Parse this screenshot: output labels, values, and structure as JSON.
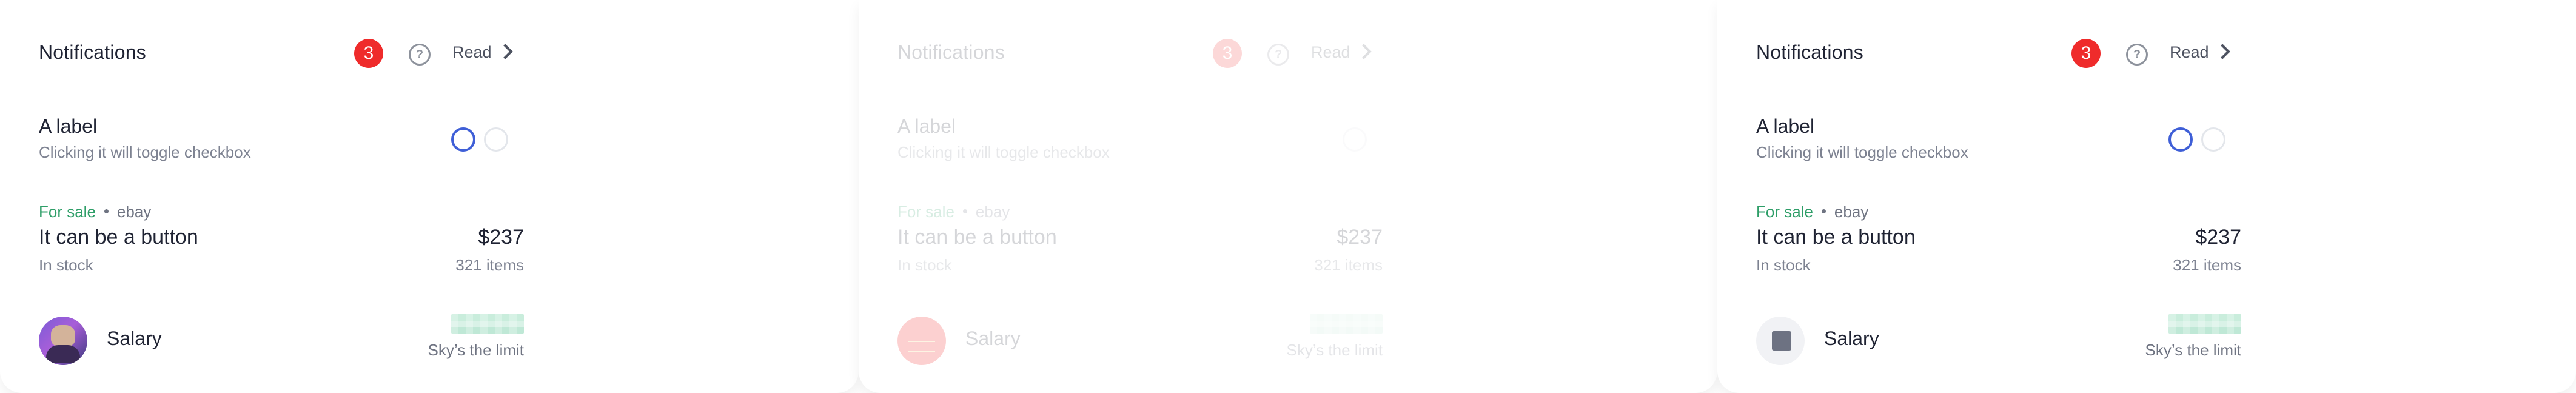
{
  "colors": {
    "badge": "#ef2b2b",
    "accent": "#3f5fd7",
    "sale": "#2e9e68",
    "text": "#1f2333",
    "muted": "#7d8291"
  },
  "panels": [
    {
      "state": "default",
      "header": {
        "title": "Notifications",
        "count": "3",
        "read_label": "Read"
      },
      "checkbox": {
        "label": "A label",
        "sub": "Clicking it will toggle checkbox"
      },
      "item": {
        "status": "For sale",
        "source": "ebay",
        "title": "It can be a button",
        "subtitle": "In stock",
        "price": "$237",
        "count": "321 items"
      },
      "salary": {
        "label": "Salary",
        "limit": "Sky’s the limit",
        "avatar": "photo"
      }
    },
    {
      "state": "disabled",
      "header": {
        "title": "Notifications",
        "count": "3",
        "read_label": "Read"
      },
      "checkbox": {
        "label": "A label",
        "sub": "Clicking it will toggle checkbox"
      },
      "item": {
        "status": "For sale",
        "source": "ebay",
        "title": "It can be a button",
        "subtitle": "In stock",
        "price": "$237",
        "count": "321 items"
      },
      "salary": {
        "label": "Salary",
        "limit": "Sky’s the limit",
        "avatar": "red"
      }
    },
    {
      "state": "default",
      "header": {
        "title": "Notifications",
        "count": "3",
        "read_label": "Read"
      },
      "checkbox": {
        "label": "A label",
        "sub": "Clicking it will toggle checkbox"
      },
      "item": {
        "status": "For sale",
        "source": "ebay",
        "title": "It can be a button",
        "subtitle": "In stock",
        "price": "$237",
        "count": "321 items"
      },
      "salary": {
        "label": "Salary",
        "limit": "Sky’s the limit",
        "avatar": "square"
      }
    }
  ]
}
